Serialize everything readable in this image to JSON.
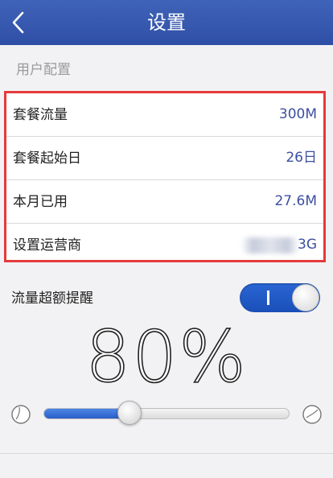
{
  "header": {
    "title": "设置",
    "back_icon": "chevron-left-icon"
  },
  "user_config": {
    "section_label": "用户配置",
    "rows": [
      {
        "label": "套餐流量",
        "value": "300M"
      },
      {
        "label": "套餐起始日",
        "value": "26日"
      },
      {
        "label": "本月已用",
        "value": "27.6M"
      },
      {
        "label": "设置运营商",
        "value": "3G"
      }
    ]
  },
  "alert": {
    "label": "流量超额提醒",
    "toggle_on": true,
    "toggle_mark": "I",
    "percent_text": "80%",
    "slider_fraction": 0.35
  },
  "colors": {
    "header": "#3455ad",
    "accent": "#2a5ec8",
    "highlight_border": "#e53a3a",
    "value_text": "#3d4fa0"
  }
}
